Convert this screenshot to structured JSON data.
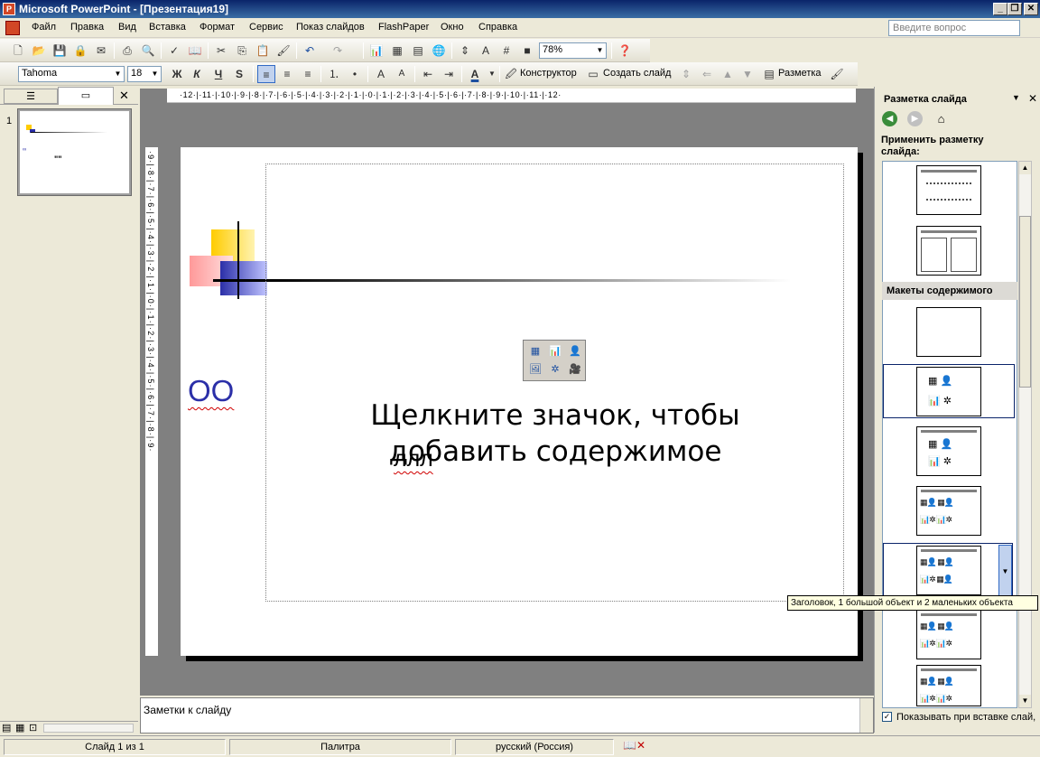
{
  "app": {
    "title": "Microsoft PowerPoint - [Презентация19]"
  },
  "menu": [
    "Файл",
    "Правка",
    "Вид",
    "Вставка",
    "Формат",
    "Сервис",
    "Показ слайдов",
    "FlashPaper",
    "Окно",
    "Справка"
  ],
  "ask": {
    "placeholder": "Введите вопрос"
  },
  "toolbar": {
    "zoom": "78%"
  },
  "format_toolbar": {
    "font": "Tahoma",
    "size": "18",
    "bold": "Ж",
    "italic": "К",
    "underline": "Ч",
    "shadow": "S",
    "designer": "Конструктор",
    "new_slide": "Создать слайд",
    "layout": "Разметка"
  },
  "slides_panel": {
    "thumb_number": "1",
    "thumb_text": "\"\""
  },
  "hruler": "·12·|·11·|·10·|·9·|·8·|·7·|·6·|·5·|·4·|·3·|·2·|·1·|·0·|·1·|·2·|·3·|·4·|·5·|·6·|·7·|·8·|·9·|·10·|·11·|·12·",
  "slide": {
    "placeholder": "Щелкните значок, чтобы добавить содержимое",
    "text_oo": "ОО",
    "text_lll": "ллл"
  },
  "notes": {
    "text": "Заметки к слайду"
  },
  "taskpane": {
    "title": "Разметка слайда",
    "apply_label": "Применить разметку слайда:",
    "section_content": "Макеты содержимого",
    "show_on_insert": "Показывать при вставке слай,"
  },
  "tooltip": {
    "text": "Заголовок, 1 большой объект и 2 маленьких объекта"
  },
  "status": {
    "slide": "Слайд 1 из 1",
    "design": "Палитра",
    "language": "русский (Россия)"
  }
}
